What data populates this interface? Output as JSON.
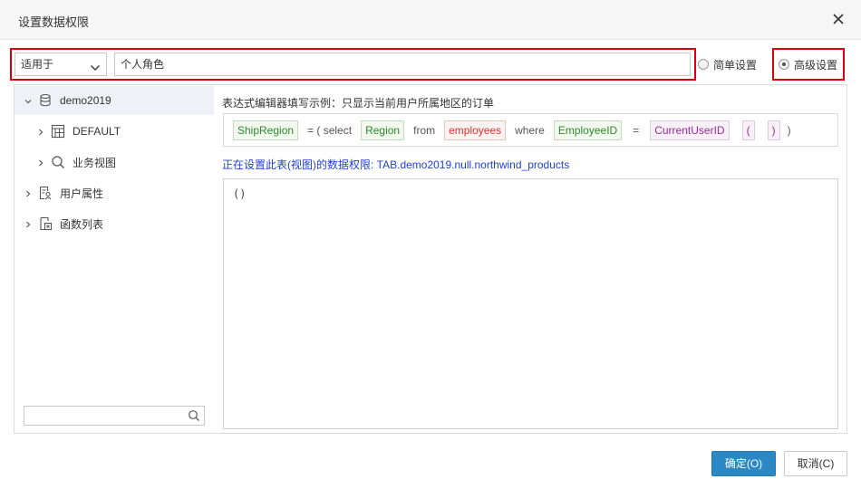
{
  "dialog": {
    "title": "设置数据权限"
  },
  "filter": {
    "scope_value": "适用于",
    "role_value": "个人角色"
  },
  "mode": {
    "simple_label": "简单设置",
    "advanced_label": "高级设置",
    "selected": "advanced"
  },
  "tree": {
    "items": [
      {
        "label": "demo2019",
        "icon": "database-icon"
      },
      {
        "label": "DEFAULT",
        "icon": "schema-table-icon"
      },
      {
        "label": "业务视图",
        "icon": "search-view-icon"
      },
      {
        "label": "用户属性",
        "icon": "user-attribute-icon"
      },
      {
        "label": "函数列表",
        "icon": "function-icon"
      }
    ]
  },
  "example": {
    "title": "表达式编辑器填写示例：只显示当前用户所属地区的订单",
    "tokens": {
      "t1": "ShipRegion",
      "p1": "= ( select",
      "t2": "Region",
      "p2": "from",
      "t3": "employees",
      "p3": "where",
      "t4": "EmployeeID",
      "p4": "=",
      "t5": "CurrentUserID",
      "t6": "(",
      "t7": ")",
      "p5": ")"
    }
  },
  "notice": "正在设置此表(视图)的数据权限: TAB.demo2019.null.northwind_products",
  "editor": {
    "content": "()"
  },
  "buttons": {
    "ok": "确定(O)",
    "cancel": "取消(C)"
  },
  "colors": {
    "accent": "#2b88c4",
    "highlight": "#d9000a",
    "notice": "#2040d8"
  }
}
